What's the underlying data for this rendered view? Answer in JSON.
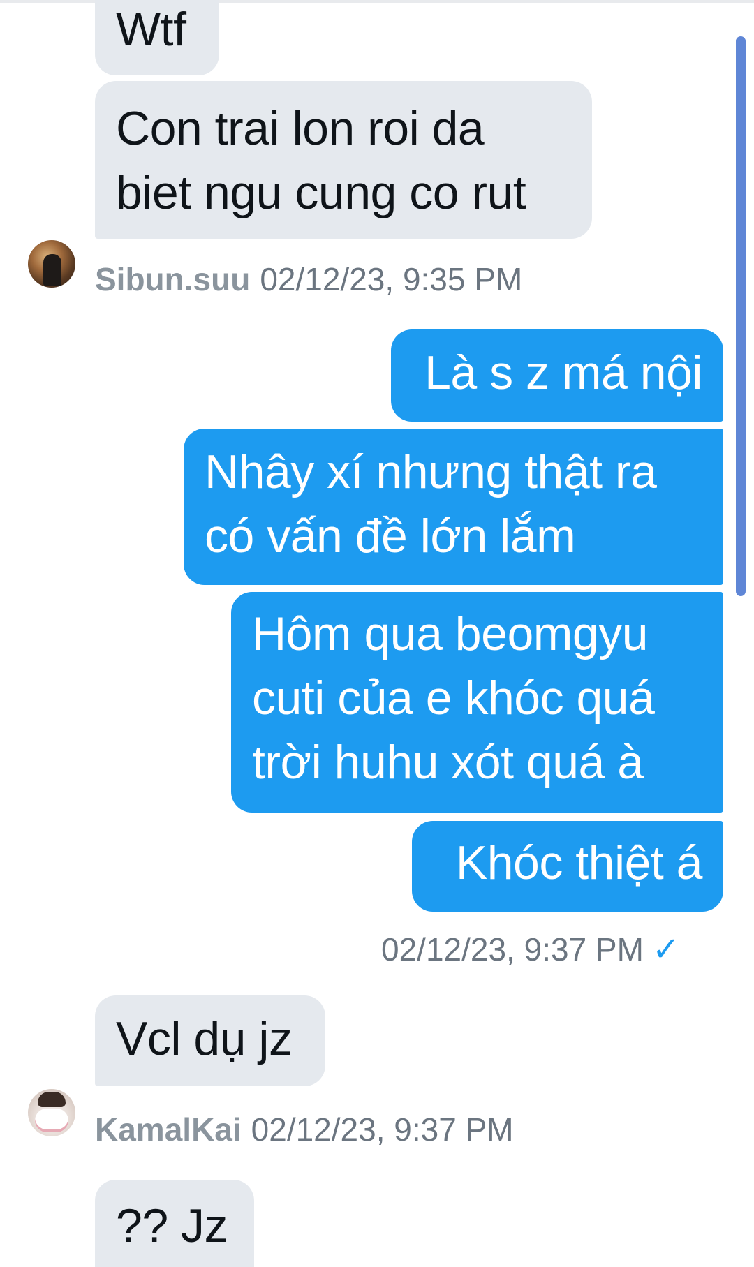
{
  "conversation": {
    "messages": [
      {
        "id": "m1",
        "direction": "in",
        "text": "Wtf"
      },
      {
        "id": "m2",
        "direction": "in",
        "text": "Con trai lon roi da\nbiet ngu cung co rut"
      },
      {
        "id": "m3",
        "direction": "out",
        "text": "Là s z má nội"
      },
      {
        "id": "m4",
        "direction": "out",
        "text": "Nhây xí nhưng thật ra\ncó vấn đề lớn lắm"
      },
      {
        "id": "m5",
        "direction": "out",
        "text": "Hôm qua beomgyu\ncuti của e khóc quá\ntrời huhu xót quá à"
      },
      {
        "id": "m6",
        "direction": "out",
        "text": "Khóc thiệt á"
      },
      {
        "id": "m7",
        "direction": "in",
        "text": "Vcl dụ jz"
      },
      {
        "id": "m8",
        "direction": "in",
        "text": "?? Jz"
      }
    ],
    "meta": {
      "group1": {
        "sender": "Sibun.suu",
        "timestamp": "02/12/23, 9:35 PM"
      },
      "group2": {
        "timestamp": "02/12/23, 9:37 PM",
        "status": "sent",
        "check_icon": "✓"
      },
      "group3": {
        "sender": "KamalKai",
        "timestamp": "02/12/23, 9:37 PM"
      }
    },
    "colors": {
      "incoming_bubble": "#e5e9ee",
      "outgoing_bubble": "#1d9bf0",
      "meta_text": "#6b7580",
      "scrollbar": "#5f86d6"
    },
    "icons": {
      "avatar_sibun": "avatar-photo",
      "avatar_kamalkai": "avatar-photo",
      "sent_status": "checkmark-icon"
    }
  }
}
